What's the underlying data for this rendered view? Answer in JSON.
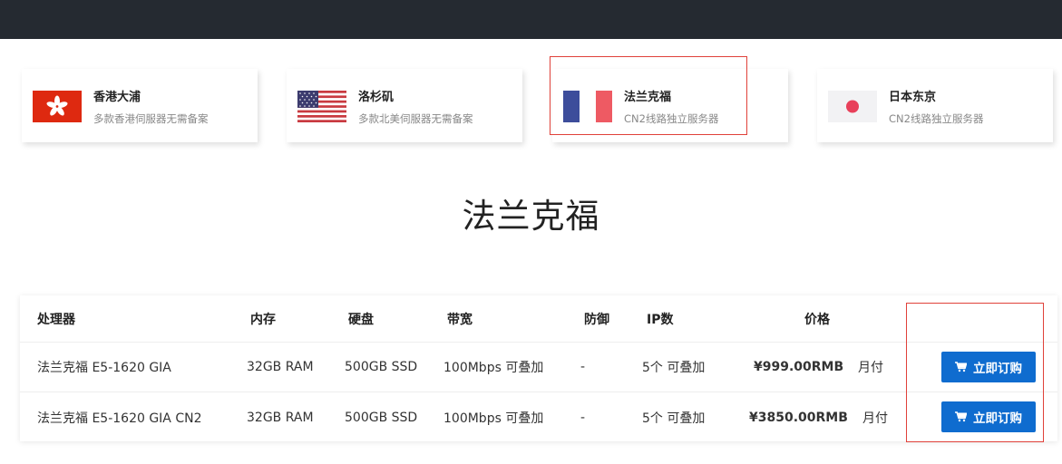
{
  "locations": [
    {
      "name": "香港大浦",
      "desc": "多款香港伺服器无需备案",
      "flag_icon": "hong-kong-flag-icon",
      "selected": false
    },
    {
      "name": "洛杉矶",
      "desc": "多款北美伺服器无需备案",
      "flag_icon": "usa-flag-icon",
      "selected": false
    },
    {
      "name": "法兰克福",
      "desc": "CN2线路独立服务器",
      "flag_icon": "france-flag-icon",
      "selected": true
    },
    {
      "name": "日本东京",
      "desc": "CN2线路独立服务器",
      "flag_icon": "japan-flag-icon",
      "selected": false
    }
  ],
  "page_title": "法兰克福",
  "table": {
    "headers": {
      "cpu": "处理器",
      "ram": "内存",
      "disk": "硬盘",
      "bandwidth": "带宽",
      "ddos": "防御",
      "ip": "IP数",
      "price": "价格"
    },
    "rows": [
      {
        "cpu": "法兰克福 E5-1620 GIA",
        "ram": "32GB RAM",
        "disk": "500GB SSD",
        "bandwidth": "100Mbps 可叠加",
        "ddos": "-",
        "ip": "5个 可叠加",
        "price": "¥999.00RMB",
        "period": "月付",
        "button": "立即订购"
      },
      {
        "cpu": "法兰克福 E5-1620 GIA CN2",
        "ram": "32GB RAM",
        "disk": "500GB SSD",
        "bandwidth": "100Mbps 可叠加",
        "ddos": "-",
        "ip": "5个 可叠加",
        "price": "¥3850.00RMB",
        "period": "月付",
        "button": "立即订购"
      }
    ]
  },
  "colors": {
    "topbar": "#252a31",
    "highlight_border": "#e0413a",
    "price": "#2e86de",
    "button": "#0f6ccf"
  }
}
